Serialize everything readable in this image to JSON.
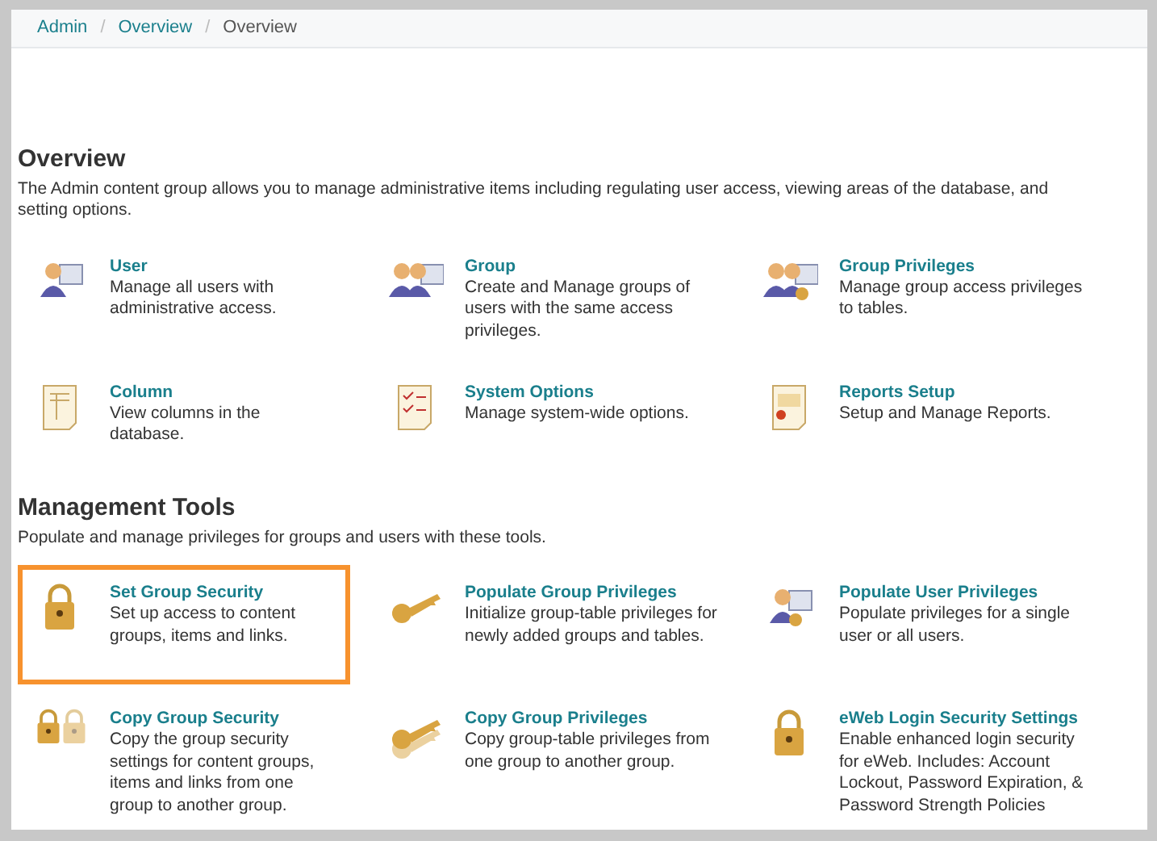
{
  "breadcrumb_separators": [
    "/",
    "/"
  ],
  "breadcrumb": [
    {
      "label": "Admin",
      "link": true
    },
    {
      "label": "Overview",
      "link": true
    },
    {
      "label": "Overview",
      "link": false
    }
  ],
  "sections": [
    {
      "title": "Overview",
      "description": "The Admin content group allows you to manage administrative items including regulating user access, viewing areas of the database, and setting options.",
      "items": [
        {
          "title": "User",
          "description": "Manage all users with administrative access.",
          "highlighted": false
        },
        {
          "title": "Group",
          "description": "Create and Manage groups of users with the same access privileges.",
          "highlighted": false
        },
        {
          "title": "Group Privileges",
          "description": "Manage group access privileges to tables.",
          "highlighted": false
        },
        {
          "title": "Column",
          "description": "View columns in the database.",
          "highlighted": false
        },
        {
          "title": "System Options",
          "description": "Manage system-wide options.",
          "highlighted": false
        },
        {
          "title": "Reports Setup",
          "description": "Setup and Manage Reports.",
          "highlighted": false
        }
      ]
    },
    {
      "title": "Management Tools",
      "description": "Populate and manage privileges for groups and users with these tools.",
      "items": [
        {
          "title": "Set Group Security",
          "description": "Set up access to content groups, items and links.",
          "highlighted": true
        },
        {
          "title": "Populate Group Privileges",
          "description": "Initialize group-table privileges for newly added groups and tables.",
          "highlighted": false
        },
        {
          "title": "Populate User Privileges",
          "description": "Populate privileges for a single user or all users.",
          "highlighted": false
        },
        {
          "title": "Copy Group Security",
          "description": "Copy the group security settings for content groups, items and links from one group to another group.",
          "highlighted": false
        },
        {
          "title": "Copy Group Privileges",
          "description": "Copy group-table privileges from one group to another group.",
          "highlighted": false
        },
        {
          "title": "eWeb Login Security Settings",
          "description": "Enable enhanced login security for eWeb. Includes: Account Lockout, Password Expiration, & Password Strength Policies",
          "highlighted": false
        }
      ]
    }
  ]
}
